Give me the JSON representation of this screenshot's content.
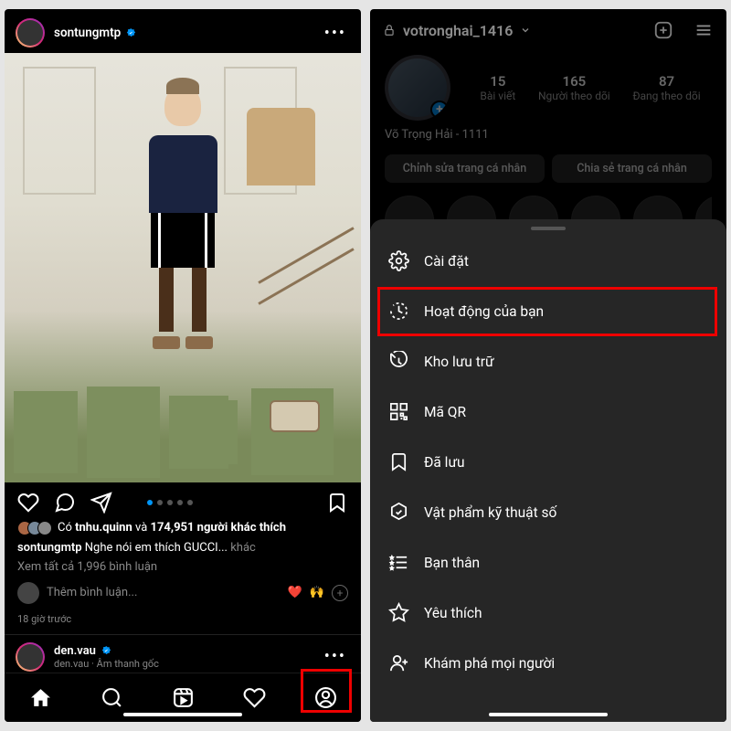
{
  "left": {
    "post": {
      "username": "sontungmtp",
      "likes_prefix": "Có ",
      "liked_by": "tnhu.quinn",
      "likes_and": " và ",
      "likes_count": "174,951 người khác thích",
      "caption_user": "sontungmtp",
      "caption_text": " Nghe nói em thích GUCCI... ",
      "caption_more": "khác",
      "view_comments": "Xem tất cả 1,996 bình luận",
      "add_comment_placeholder": "Thêm bình luận...",
      "emoji_heart": "❤️",
      "emoji_hands": "🙌",
      "time": "18 giờ trước"
    },
    "second_post": {
      "username": "den.vau",
      "subtitle": "den.vau · Âm thanh gốc"
    }
  },
  "right": {
    "username": "votronghai_1416",
    "stats": {
      "posts_n": "15",
      "posts_l": "Bài viết",
      "followers_n": "165",
      "followers_l": "Người theo dõi",
      "following_n": "87",
      "following_l": "Đang theo dõi"
    },
    "display_name": "Võ Trọng Hải - 1111",
    "edit_btn": "Chỉnh sửa trang cá nhân",
    "share_btn": "Chia sẻ trang cá nhân",
    "menu": {
      "settings": "Cài đặt",
      "activity": "Hoạt động của bạn",
      "archive": "Kho lưu trữ",
      "qr": "Mã QR",
      "saved": "Đã lưu",
      "digital": "Vật phẩm kỹ thuật số",
      "close_friends": "Bạn thân",
      "favorites": "Yêu thích",
      "discover": "Khám phá mọi người"
    }
  }
}
